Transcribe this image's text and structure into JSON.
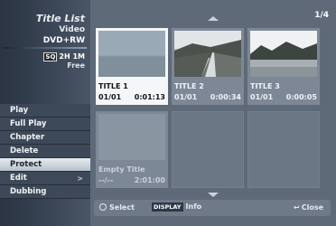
{
  "left": {
    "title": "Title List",
    "subtitle": "Video",
    "disc": "DVD+RW",
    "rec_mode": "SQ",
    "rec_time": "2H 1M",
    "rec_free": "Free"
  },
  "menu": {
    "items": [
      {
        "label": "Play"
      },
      {
        "label": "Full Play"
      },
      {
        "label": "Chapter"
      },
      {
        "label": "Delete"
      },
      {
        "label": "Protect"
      },
      {
        "label": "Edit",
        "arrow": ">"
      },
      {
        "label": "Dubbing"
      }
    ],
    "selected": "Protect"
  },
  "page_counter": "1/4",
  "titles": [
    {
      "name": "TITLE 1",
      "date": "01/01",
      "duration": "0:01:13",
      "selected": true
    },
    {
      "name": "TITLE 2",
      "date": "01/01",
      "duration": "0:00:34"
    },
    {
      "name": "TITLE 3",
      "date": "01/01",
      "duration": "0:00:05"
    },
    {
      "name": "Empty Title",
      "date": "--/--",
      "duration": "2:01:00"
    }
  ],
  "bottom": {
    "select": "Select",
    "display_tag": "DISPLAY",
    "info": "Info",
    "close": "Close"
  },
  "colors": {
    "panel": "#3d4958",
    "selected_menu": "#e7ebef",
    "background": "#5e6a78"
  }
}
